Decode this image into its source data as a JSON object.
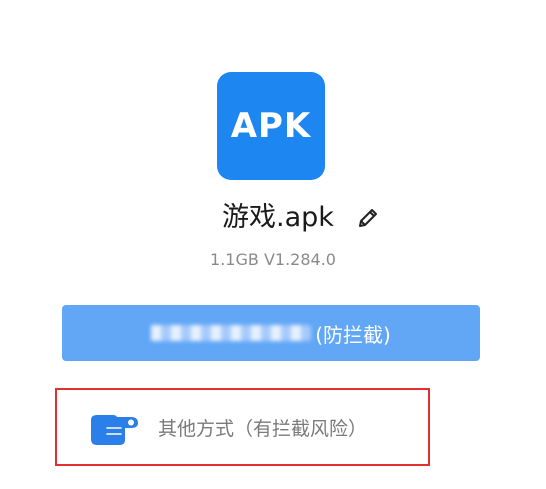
{
  "app": {
    "icon_text": "APK",
    "icon_color": "#1e86f0",
    "file_name": "游戏.apk",
    "meta": "1.1GB V1.284.0"
  },
  "download_button": {
    "label": "(防拦截)",
    "color": "#62a6f6"
  },
  "alternative": {
    "label": "其他方式（有拦截风险）",
    "hand_color": "#2b7fe8",
    "highlight_color": "#e3302f"
  },
  "icons": {
    "edit": "pencil-icon",
    "hand": "pointing-hand-icon"
  }
}
